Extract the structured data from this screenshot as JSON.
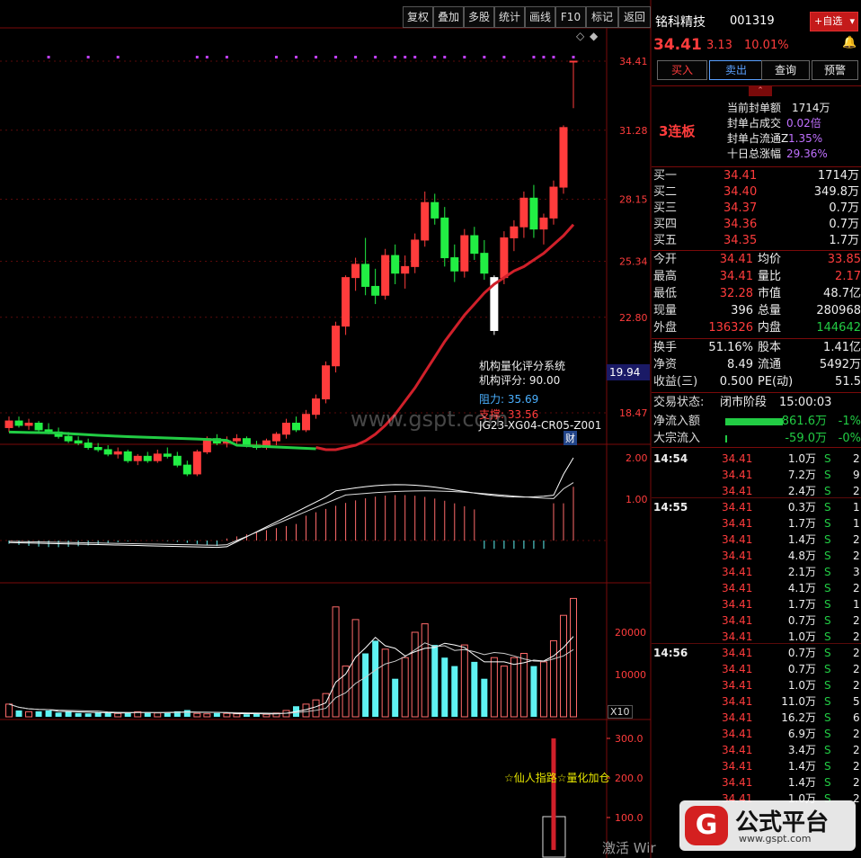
{
  "toolbar": {
    "buttons": [
      "复权",
      "叠加",
      "多股",
      "统计",
      "画线",
      "F10",
      "标记",
      "返回"
    ]
  },
  "stock": {
    "name": "铭科精技",
    "code": "001319",
    "add_label": "+自选",
    "price": "34.41",
    "change": "3.13",
    "change_pct": "10.01%",
    "buy_label": "买入",
    "sell_label": "卖出",
    "query_label": "查询",
    "alert_label": "预警"
  },
  "limit": {
    "streak": "3连板",
    "rows": [
      {
        "label": "当前封单额",
        "value": "1714万"
      },
      {
        "label": "封单占成交",
        "value": "0.02倍"
      },
      {
        "label": "封单占流通Z",
        "value": "1.35%"
      },
      {
        "label": "十日总涨幅",
        "value": "29.36%"
      }
    ]
  },
  "book": [
    {
      "label": "买一",
      "price": "34.41",
      "vol": "1714万"
    },
    {
      "label": "买二",
      "price": "34.40",
      "vol": "349.8万"
    },
    {
      "label": "买三",
      "price": "34.37",
      "vol": "0.7万"
    },
    {
      "label": "买四",
      "price": "34.36",
      "vol": "0.7万"
    },
    {
      "label": "买五",
      "price": "34.35",
      "vol": "1.7万"
    }
  ],
  "quote": [
    {
      "l1": "今开",
      "v1": "34.41",
      "c1": "red",
      "l2": "均价",
      "v2": "33.85",
      "c2": "red"
    },
    {
      "l1": "最高",
      "v1": "34.41",
      "c1": "red",
      "l2": "量比",
      "v2": "2.17",
      "c2": "red"
    },
    {
      "l1": "最低",
      "v1": "32.28",
      "c1": "red",
      "l2": "市值",
      "v2": "48.7亿",
      "c2": "wht"
    },
    {
      "l1": "现量",
      "v1": "396",
      "c1": "wht",
      "l2": "总量",
      "v2": "280968",
      "c2": "wht"
    },
    {
      "l1": "外盘",
      "v1": "136326",
      "c1": "red",
      "l2": "内盘",
      "v2": "144642",
      "c2": "grn"
    }
  ],
  "quote2": [
    {
      "l1": "换手",
      "v1": "51.16%",
      "l2": "股本",
      "v2": "1.41亿"
    },
    {
      "l1": "净资",
      "v1": "8.49",
      "l2": "流通",
      "v2": "5492万"
    },
    {
      "l1": "收益(三)",
      "v1": "0.500",
      "l2": "PE(动)",
      "v2": "51.5"
    }
  ],
  "status": {
    "label": "交易状态:",
    "value": "闭市阶段",
    "time": "15:00:03"
  },
  "flows": [
    {
      "label": "净流入额",
      "value": "-861.6万",
      "pct": "-1%",
      "bar": 0.85
    },
    {
      "label": "大宗流入",
      "value": "-59.0万",
      "pct": "-0%",
      "bar": 0.03
    }
  ],
  "ticks": [
    {
      "t": "14:54",
      "p": "34.41",
      "v": "1.0万",
      "s": "S",
      "n": "2"
    },
    {
      "t": "",
      "p": "34.41",
      "v": "7.2万",
      "s": "S",
      "n": "9"
    },
    {
      "t": "",
      "p": "34.41",
      "v": "2.4万",
      "s": "S",
      "n": "2"
    },
    {
      "t": "14:55",
      "p": "34.41",
      "v": "0.3万",
      "s": "S",
      "n": "1"
    },
    {
      "t": "",
      "p": "34.41",
      "v": "1.7万",
      "s": "S",
      "n": "1"
    },
    {
      "t": "",
      "p": "34.41",
      "v": "1.4万",
      "s": "S",
      "n": "2"
    },
    {
      "t": "",
      "p": "34.41",
      "v": "4.8万",
      "s": "S",
      "n": "2"
    },
    {
      "t": "",
      "p": "34.41",
      "v": "2.1万",
      "s": "S",
      "n": "3"
    },
    {
      "t": "",
      "p": "34.41",
      "v": "4.1万",
      "s": "S",
      "n": "2"
    },
    {
      "t": "",
      "p": "34.41",
      "v": "1.7万",
      "s": "S",
      "n": "1"
    },
    {
      "t": "",
      "p": "34.41",
      "v": "0.7万",
      "s": "S",
      "n": "2"
    },
    {
      "t": "",
      "p": "34.41",
      "v": "1.0万",
      "s": "S",
      "n": "2"
    },
    {
      "t": "14:56",
      "p": "34.41",
      "v": "0.7万",
      "s": "S",
      "n": "2"
    },
    {
      "t": "",
      "p": "34.41",
      "v": "0.7万",
      "s": "S",
      "n": "2"
    },
    {
      "t": "",
      "p": "34.41",
      "v": "1.0万",
      "s": "S",
      "n": "2"
    },
    {
      "t": "",
      "p": "34.41",
      "v": "11.0万",
      "s": "S",
      "n": "5"
    },
    {
      "t": "",
      "p": "34.41",
      "v": "16.2万",
      "s": "S",
      "n": "6"
    },
    {
      "t": "",
      "p": "34.41",
      "v": "6.9万",
      "s": "S",
      "n": "2"
    },
    {
      "t": "",
      "p": "34.41",
      "v": "3.4万",
      "s": "S",
      "n": "2"
    },
    {
      "t": "",
      "p": "34.41",
      "v": "1.4万",
      "s": "S",
      "n": "2"
    },
    {
      "t": "",
      "p": "34.41",
      "v": "1.4万",
      "s": "S",
      "n": "2"
    },
    {
      "t": "",
      "p": "34.41",
      "v": "1.0万",
      "s": "S",
      "n": "2"
    }
  ],
  "overlay": {
    "system_title": "机构量化评分系统",
    "score_label": "机构评分:",
    "score": "90.00",
    "resist_label": "阻力:",
    "resist": "35.69",
    "support_label": "支撑:",
    "support": "33.56",
    "code_text": "JG23-XG04-CR05-Z001",
    "cai": "财",
    "signal_text": "☆仙人指路☆量化加仓",
    "watermark": "www.gspt.com",
    "activate": "激活 Wir",
    "logo_text": "公式平台",
    "logo_url": "www.gspt.com",
    "price_tag": "19.94",
    "x10": "X10"
  },
  "axes": {
    "price_ticks": [
      "34.41",
      "31.28",
      "28.15",
      "25.34",
      "22.80",
      "18.47"
    ],
    "macd_ticks": [
      "2.00",
      "1.00"
    ],
    "vol_ticks": [
      "20000",
      "10000"
    ],
    "ind_ticks": [
      "300.0",
      "200.0",
      "100.0"
    ]
  },
  "chart_data": {
    "type": "candlestick",
    "candles": [
      [
        17.8,
        18.3,
        17.6,
        18.1
      ],
      [
        18.1,
        18.3,
        17.8,
        17.9
      ],
      [
        17.9,
        18.2,
        17.7,
        18.0
      ],
      [
        18.0,
        18.1,
        17.6,
        17.7
      ],
      [
        17.7,
        18.0,
        17.5,
        17.6
      ],
      [
        17.6,
        17.8,
        17.3,
        17.4
      ],
      [
        17.4,
        17.6,
        17.1,
        17.2
      ],
      [
        17.2,
        17.4,
        17.0,
        17.1
      ],
      [
        17.1,
        17.3,
        16.8,
        16.9
      ],
      [
        16.9,
        17.1,
        16.7,
        16.8
      ],
      [
        16.8,
        17.0,
        16.5,
        16.6
      ],
      [
        16.6,
        16.9,
        16.4,
        16.7
      ],
      [
        16.7,
        16.8,
        16.2,
        16.3
      ],
      [
        16.3,
        16.6,
        16.1,
        16.5
      ],
      [
        16.5,
        16.7,
        16.2,
        16.3
      ],
      [
        16.3,
        16.8,
        16.2,
        16.6
      ],
      [
        16.6,
        16.9,
        16.4,
        16.5
      ],
      [
        16.5,
        16.7,
        16.0,
        16.1
      ],
      [
        16.1,
        16.3,
        15.6,
        15.7
      ],
      [
        15.7,
        16.8,
        15.6,
        16.7
      ],
      [
        16.7,
        17.4,
        16.6,
        17.3
      ],
      [
        17.3,
        17.5,
        17.0,
        17.1
      ],
      [
        17.1,
        17.4,
        16.9,
        17.2
      ],
      [
        17.2,
        17.5,
        17.0,
        17.3
      ],
      [
        17.3,
        17.4,
        16.9,
        17.0
      ],
      [
        17.0,
        17.2,
        16.8,
        16.9
      ],
      [
        16.9,
        17.3,
        16.8,
        17.2
      ],
      [
        17.2,
        17.6,
        17.0,
        17.5
      ],
      [
        17.5,
        18.2,
        17.3,
        18.0
      ],
      [
        18.0,
        18.3,
        17.6,
        17.7
      ],
      [
        17.7,
        18.6,
        17.6,
        18.4
      ],
      [
        18.4,
        19.3,
        18.2,
        19.1
      ],
      [
        19.1,
        20.8,
        18.9,
        20.6
      ],
      [
        20.6,
        22.6,
        20.3,
        22.4
      ],
      [
        22.4,
        24.7,
        22.0,
        24.6
      ],
      [
        24.6,
        25.5,
        24.0,
        25.2
      ],
      [
        25.2,
        26.4,
        23.8,
        24.2
      ],
      [
        24.2,
        25.0,
        23.4,
        23.8
      ],
      [
        23.8,
        25.9,
        23.6,
        25.6
      ],
      [
        25.6,
        26.1,
        24.3,
        24.8
      ],
      [
        24.8,
        25.6,
        24.1,
        25.1
      ],
      [
        25.1,
        26.6,
        24.8,
        26.3
      ],
      [
        26.3,
        28.5,
        26.0,
        28.0
      ],
      [
        28.0,
        28.4,
        27.0,
        27.3
      ],
      [
        27.3,
        27.8,
        25.1,
        25.5
      ],
      [
        25.5,
        26.1,
        24.4,
        24.9
      ],
      [
        24.9,
        26.8,
        24.6,
        26.5
      ],
      [
        26.5,
        26.9,
        25.4,
        25.7
      ],
      [
        25.7,
        26.3,
        24.5,
        24.8
      ],
      [
        22.2,
        24.7,
        22.0,
        24.6
      ],
      [
        24.6,
        26.7,
        24.3,
        26.4
      ],
      [
        26.4,
        27.2,
        25.8,
        26.9
      ],
      [
        26.9,
        28.5,
        26.4,
        28.2
      ],
      [
        28.2,
        28.8,
        26.4,
        26.8
      ],
      [
        26.8,
        27.5,
        26.1,
        27.3
      ],
      [
        27.3,
        29.0,
        27.0,
        28.7
      ],
      [
        28.7,
        31.5,
        28.4,
        31.4
      ],
      [
        34.41,
        34.41,
        32.28,
        34.41
      ]
    ],
    "ma_red": [
      16.9,
      16.8,
      16.8,
      16.9,
      17.0,
      17.2,
      17.5,
      17.9,
      18.4,
      19.0,
      19.6,
      20.3,
      21.0,
      21.7,
      22.3,
      22.9,
      23.4,
      23.9,
      24.3,
      24.6,
      24.9,
      25.1,
      25.4,
      25.7,
      26.1,
      26.5,
      27.0
    ],
    "signal_value": 300
  }
}
